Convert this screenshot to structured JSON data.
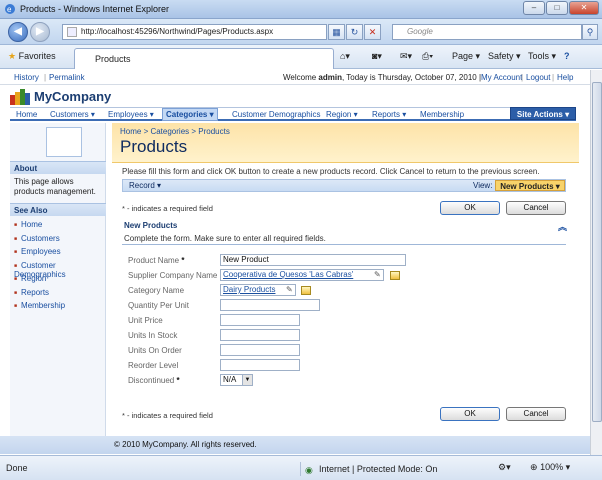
{
  "window": {
    "title": "Products - Windows Internet Explorer",
    "minimize": "–",
    "maximize": "□",
    "close": "✕"
  },
  "nav": {
    "back": "◀",
    "forward": "▶",
    "url": "http://localhost:45296/Northwind/Pages/Products.aspx",
    "search_placeholder": "Google"
  },
  "favbar": {
    "favorites": "Favorites",
    "tab_title": "Products",
    "page": "Page ▾",
    "safety": "Safety ▾",
    "tools": "Tools ▾",
    "help": "?"
  },
  "top": {
    "history": "History",
    "permalink": "Permalink",
    "welcome_prefix": "Welcome ",
    "user": "admin",
    "welcome_suffix": ", Today is Thursday, October 07, 2010 |",
    "my_account": "My Account",
    "logout": "Logout",
    "help": "Help"
  },
  "brand": {
    "name": "MyCompany"
  },
  "menu": {
    "items": [
      "Home",
      "Customers ▾",
      "Employees ▾",
      "Categories ▾",
      "Customer Demographics",
      "Region ▾",
      "Reports ▾",
      "Membership"
    ],
    "site_actions": "Site Actions ▾"
  },
  "sidebar": {
    "about_title": "About",
    "about_text": "This page allows products management.",
    "see_also_title": "See Also",
    "links": [
      "Home",
      "Customers",
      "Employees",
      "Customer Demographics",
      "Region",
      "Reports",
      "Membership"
    ]
  },
  "page": {
    "breadcrumb": "Home > Categories > Products",
    "title": "Products",
    "description": "Please fill this form and click OK button to create a new products record. Click Cancel to return to the previous screen.",
    "record_menu": "Record ▾",
    "view_label": "View:",
    "view_value": "New Products ▾",
    "required_note": "* - indicates a required field",
    "ok": "OK",
    "cancel": "Cancel"
  },
  "form": {
    "section_title": "New Products",
    "section_desc": "Complete the form. Make sure to enter all required fields.",
    "fields": [
      {
        "label": "Product Name",
        "required": "*",
        "value": "New Product"
      },
      {
        "label": "Supplier Company Name",
        "required": "",
        "value": "Cooperativa de Quesos 'Las Cabras'"
      },
      {
        "label": "Category Name",
        "required": "",
        "value": "Dairy Products"
      },
      {
        "label": "Quantity Per Unit",
        "required": "",
        "value": ""
      },
      {
        "label": "Unit Price",
        "required": "",
        "value": ""
      },
      {
        "label": "Units In Stock",
        "required": "",
        "value": ""
      },
      {
        "label": "Units On Order",
        "required": "",
        "value": ""
      },
      {
        "label": "Reorder Level",
        "required": "",
        "value": ""
      },
      {
        "label": "Discontinued",
        "required": "*",
        "value": "N/A"
      }
    ]
  },
  "footer": {
    "copyright": "© 2010 MyCompany. All rights reserved."
  },
  "status": {
    "done": "Done",
    "zone": "Internet | Protected Mode: On",
    "zoom": "100%"
  }
}
